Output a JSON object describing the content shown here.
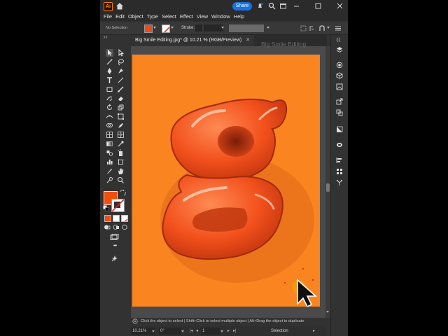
{
  "app": {
    "logo_text": "Ai",
    "share_label": "Share"
  },
  "menu": [
    "File",
    "Edit",
    "Object",
    "Type",
    "Select",
    "Effect",
    "View",
    "Window",
    "Help"
  ],
  "control_bar": {
    "selection_text": "No Selection",
    "stroke_label": "Stroke:",
    "fill_color": "#f04a1a"
  },
  "document": {
    "tab_title": "Big Smile Editing.jpg* @ 10.21 % (RGB/Preview)",
    "close_glyph": "✕",
    "watermark": "Big Smile Editing",
    "artboard_color": "#fa8420",
    "letter_color": "#f2501c"
  },
  "toolbar": {
    "fill_color": "#f0500f",
    "more_glyph": "•••"
  },
  "status": {
    "hint": "Click the object to select  |  Shift+Click to select multiple object  |  Alt+Drag the object to duplicate",
    "zoom": "10.21%",
    "rotation": "0°",
    "artboard_number": "1",
    "mode": "Selection"
  }
}
